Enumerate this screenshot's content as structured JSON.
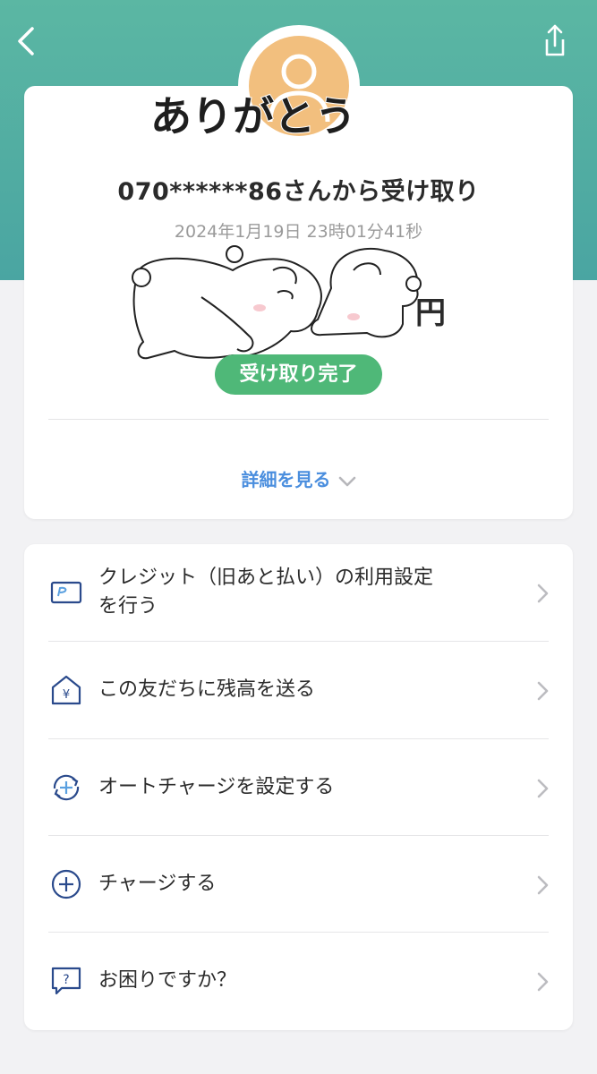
{
  "colors": {
    "header": "#5bb7a3",
    "accent_green": "#4fb878",
    "link_blue": "#4a8ede",
    "icon_navy": "#2a4a8c",
    "avatar_orange": "#f2bf7e"
  },
  "header": {
    "back_icon": "chevron-left-icon",
    "share_icon": "share-icon"
  },
  "transaction": {
    "sticker_text": "ありがとう",
    "title": "070******86さんから受け取り",
    "datetime": "2024年1月19日 23時01分41秒",
    "amount_unit": "円",
    "status": "受け取り完了",
    "details_label": "詳細を見る"
  },
  "menu": {
    "items": [
      {
        "label_line1": "クレジット（旧あと払い）の利用設定",
        "label_line2": "を行う",
        "icon": "credit-card-icon"
      },
      {
        "label": "この友だちに残高を送る",
        "icon": "yen-house-icon"
      },
      {
        "label": "オートチャージを設定する",
        "icon": "auto-charge-icon"
      },
      {
        "label": "チャージする",
        "icon": "plus-circle-icon"
      },
      {
        "label": "お困りですか？",
        "icon": "help-chat-icon"
      }
    ]
  }
}
